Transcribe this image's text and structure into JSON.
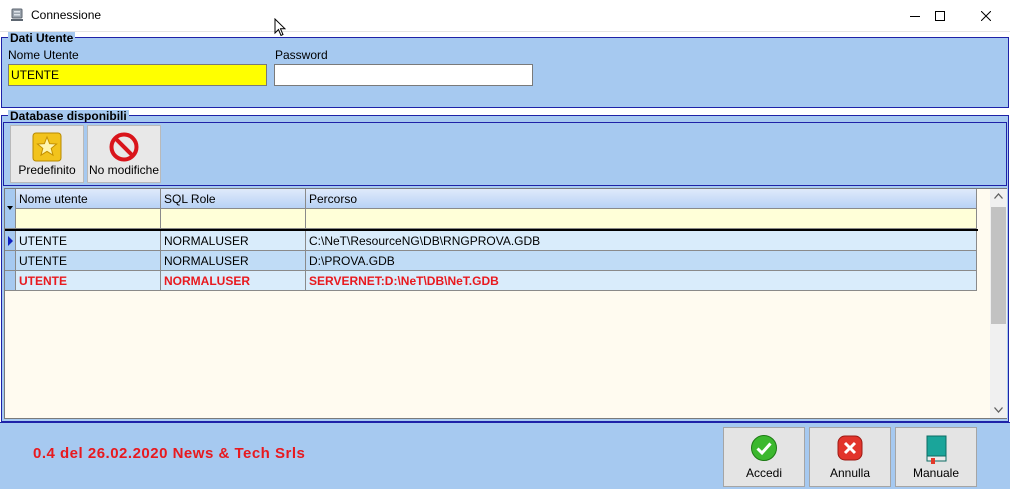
{
  "window": {
    "title": "Connessione"
  },
  "dati_utente": {
    "caption": "Dati Utente",
    "nome_utente_label": "Nome Utente",
    "nome_utente_value": "UTENTE",
    "password_label": "Password",
    "password_value": ""
  },
  "database": {
    "caption": "Database disponibili",
    "toolbar": {
      "predefinito_label": "Predefinito",
      "no_modifiche_label": "No modifiche"
    },
    "columns": [
      "Nome utente",
      "SQL Role",
      "Percorso"
    ],
    "rows": [
      {
        "nome_utente": "UTENTE",
        "sql_role": "NORMALUSER",
        "percorso": "C:\\NeT\\ResourceNG\\DB\\RNGPROVA.GDB"
      },
      {
        "nome_utente": "UTENTE",
        "sql_role": "NORMALUSER",
        "percorso": "D:\\PROVA.GDB"
      },
      {
        "nome_utente": "UTENTE",
        "sql_role": "NORMALUSER",
        "percorso": "SERVERNET:D:\\NeT\\DB\\NeT.GDB"
      }
    ]
  },
  "footer": {
    "version": "0.4 del 26.02.2020 News & Tech Srls",
    "accedi_label": "Accedi",
    "annulla_label": "Annulla",
    "manuale_label": "Manuale"
  },
  "colors": {
    "panel_bg": "#a6c9f0",
    "border": "#1e22a8",
    "highlight_input": "#ffff00",
    "default_row_text": "#e8191e",
    "version_text": "#e8191e"
  }
}
